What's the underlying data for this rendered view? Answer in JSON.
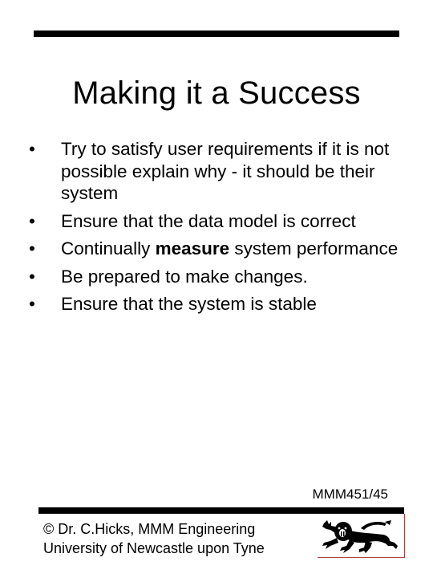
{
  "slide": {
    "title": "Making it a Success",
    "bullets": [
      {
        "before": "Try to satisfy user requirements if it is not possible explain why - it should be their system",
        "bold": "",
        "after": ""
      },
      {
        "before": "Ensure that the data model is correct",
        "bold": "",
        "after": ""
      },
      {
        "before": "Continually ",
        "bold": "measure",
        "after": " system performance"
      },
      {
        "before": "Be prepared to make changes.",
        "bold": "",
        "after": ""
      },
      {
        "before": "Ensure that the system is stable",
        "bold": "",
        "after": ""
      }
    ],
    "bullet_glyph": "•",
    "slide_number": "MMM451/45",
    "footer": {
      "line1": "© Dr. C.Hicks, MMM Engineering",
      "line2": "University of Newcastle upon Tyne"
    },
    "logo": "lion-passant-icon",
    "colors": {
      "text": "#000000",
      "rule": "#000000",
      "logo_border": "#b04040"
    }
  }
}
